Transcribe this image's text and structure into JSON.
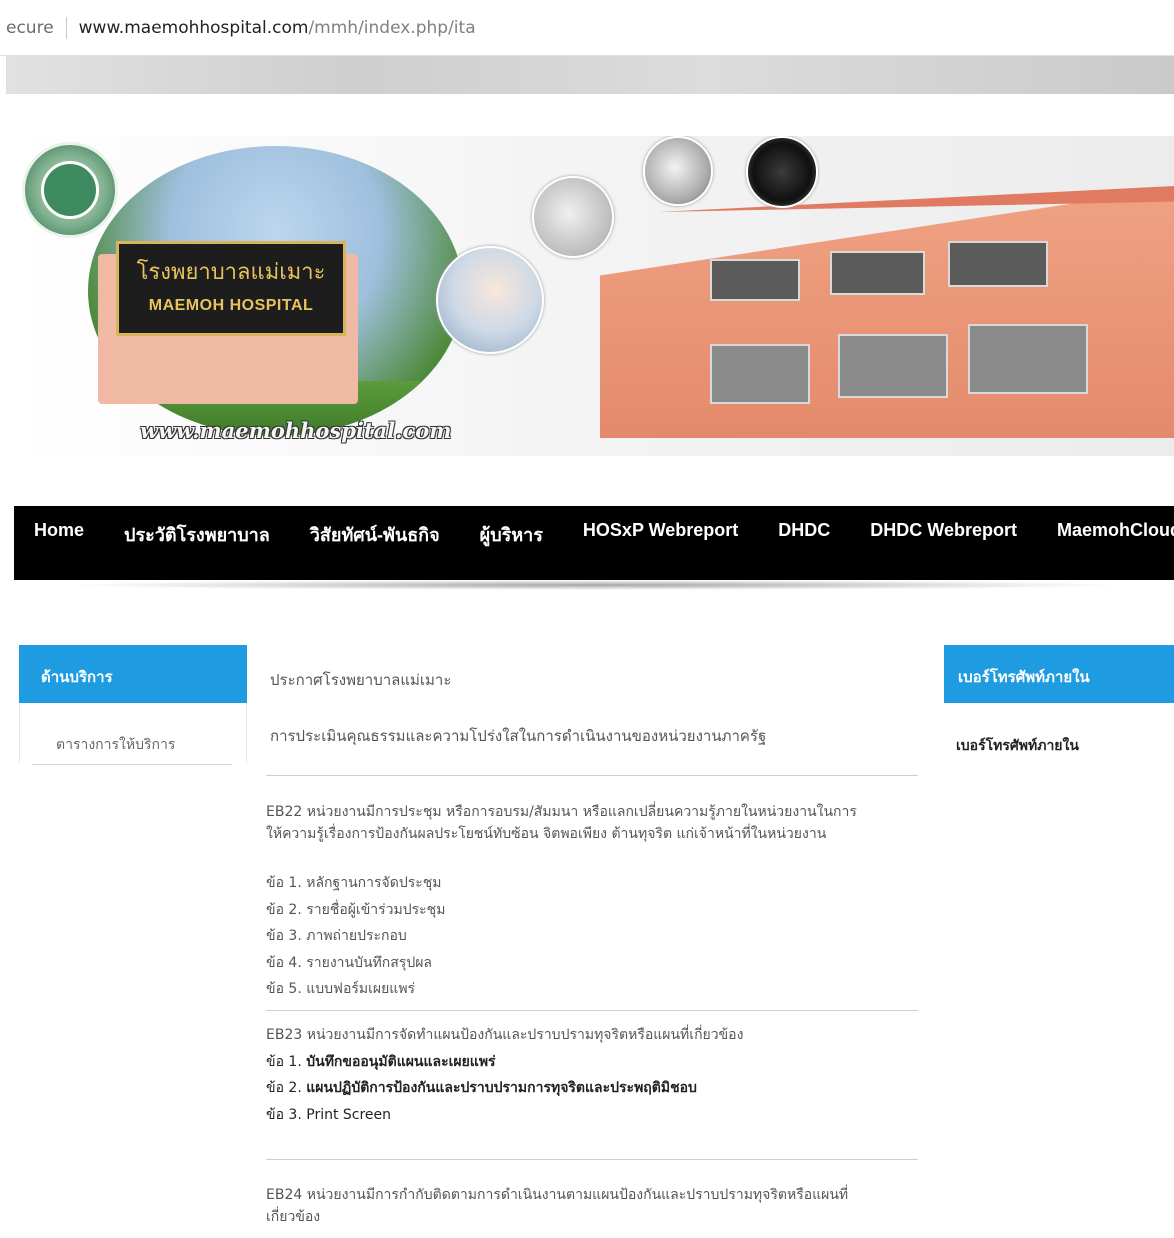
{
  "address_bar": {
    "secure": "ecure",
    "host": "www.maemohhospital.com",
    "path": "/mmh/index.php/ita"
  },
  "banner": {
    "sign_th": "โรงพยาบาลแม่เมาะ",
    "sign_en": "MAEMOH HOSPITAL",
    "site_url": "www.maemohhospital.com"
  },
  "nav": {
    "items": [
      {
        "label": "Home"
      },
      {
        "label": "ประวัติโรงพยาบาล"
      },
      {
        "label": "วิสัยทัศน์-พันธกิจ"
      },
      {
        "label": "ผู้บริหาร"
      },
      {
        "label": "HOSxP Webreport"
      },
      {
        "label": "DHDC"
      },
      {
        "label": "DHDC Webreport"
      },
      {
        "label": "MaemohCloud"
      }
    ]
  },
  "left_sidebar": {
    "title": "ด้านบริการ",
    "items": [
      {
        "label": "ตารางการให้บริการ"
      }
    ]
  },
  "right_sidebar": {
    "title": "เบอร์โทรศัพท์ภายใน",
    "items": [
      {
        "label": "เบอร์โทรศัพท์ภายใน"
      }
    ]
  },
  "main": {
    "announcement_title": "ประกาศโรงพยาบาลแม่เมาะ",
    "announcement_subtitle": "การประเมินคุณธรรมและความโปร่งใสในการดำเนินงานของหน่วยงานภาครัฐ",
    "eb22": {
      "line1": "EB22 หน่วยงานมีการประชุม หรือการอบรม/สัมมนา หรือแลกเปลี่ยนความรู้ภายในหน่วยงานในการ",
      "line2": "ให้ความรู้เรื่องการป้องกันผลประโยชน์ทับซ้อน จิตพอเพียง ต้านทุจริต แก่เจ้าหน้าที่ในหน่วยงาน",
      "items": [
        "ข้อ 1. หลักฐานการจัดประชุม",
        "ข้อ 2. รายชื่อผู้เข้าร่วมประชุม",
        "ข้อ 3. ภาพถ่ายประกอบ",
        "ข้อ 4. รายงานบันทึกสรุปผล",
        "ข้อ 5. แบบฟอร์มเผยแพร่"
      ]
    },
    "eb23": {
      "title": "EB23 หน่วยงานมีการจัดทำแผนป้องกันและปราบปรามทุจริตหรือแผนที่เกี่ยวข้อง",
      "items": [
        {
          "prefix": "ข้อ 1. ",
          "text": "บันทึกขออนุมัติแผนและเผยแพร่"
        },
        {
          "prefix": "ข้อ 2. ",
          "text": "แผนปฏิบัติการป้องกันและปราบปรามการทุจริตและประพฤติมิชอบ"
        },
        {
          "prefix": "ข้อ 3. ",
          "text": "Print Screen"
        }
      ]
    },
    "eb24": {
      "line1": "EB24 หน่วยงานมีการกำกับติดตามการดำเนินงานตามแผนป้องกันและปราบปรามทุจริตหรือแผนที่",
      "line2": "เกี่ยวข้อง"
    }
  }
}
